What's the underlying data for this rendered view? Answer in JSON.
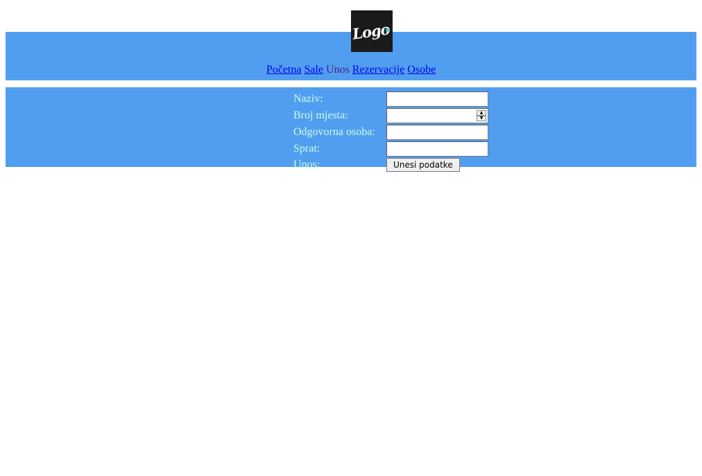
{
  "logo": {
    "text": "Logo"
  },
  "nav": {
    "items": [
      {
        "label": "Početna"
      },
      {
        "label": "Sale"
      },
      {
        "label": "Unos"
      },
      {
        "label": "Rezervacije"
      },
      {
        "label": "Osobe"
      }
    ]
  },
  "form": {
    "naziv_label": "Naziv:",
    "naziv_value": "",
    "broj_mjesta_label": "Broj mjesta:",
    "broj_mjesta_value": "",
    "odgovorna_osoba_label": "Odgovorna osoba:",
    "odgovorna_osoba_value": "",
    "sprat_label": "Sprat:",
    "sprat_value": "",
    "unos_label": "Unos:",
    "submit_label": "Unesi podatke"
  },
  "colors": {
    "band": "#519ef0",
    "label_text": "#c9ffea",
    "link": "#0000ee",
    "visited": "#551a8b"
  },
  "icons": {
    "spinner_up": "spinner-up-icon",
    "spinner_down": "spinner-down-icon"
  }
}
